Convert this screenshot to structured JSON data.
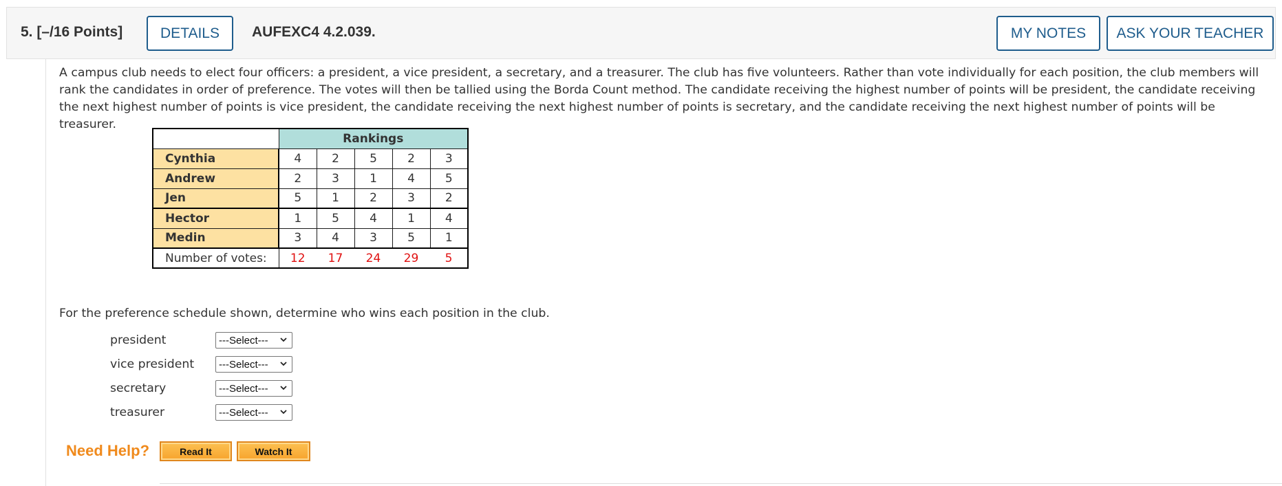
{
  "header": {
    "question_number": "5.  [–/16 Points]",
    "details_label": "DETAILS",
    "question_code": "AUFEXC4 4.2.039.",
    "my_notes_label": "MY NOTES",
    "ask_teacher_label": "ASK YOUR TEACHER"
  },
  "intro_text": "A campus club needs to elect four officers: a president, a vice president, a secretary, and a treasurer. The club has five volunteers. Rather than vote individually for each position, the club members will rank the candidates in order of preference. The votes will then be tallied using the Borda Count method. The candidate receiving the highest number of points will be president, the candidate receiving the next highest number of points is vice president, the candidate receiving the next highest number of points is secretary, and the candidate receiving the next highest number of points will be treasurer.",
  "table": {
    "header": "Rankings",
    "rows": [
      {
        "name": "Cynthia",
        "values": [
          "4",
          "2",
          "5",
          "2",
          "3"
        ]
      },
      {
        "name": "Andrew",
        "values": [
          "2",
          "3",
          "1",
          "4",
          "5"
        ]
      },
      {
        "name": "Jen",
        "values": [
          "5",
          "1",
          "2",
          "3",
          "2"
        ]
      },
      {
        "name": "Hector",
        "values": [
          "1",
          "5",
          "4",
          "1",
          "4"
        ]
      },
      {
        "name": "Medin",
        "values": [
          "3",
          "4",
          "3",
          "5",
          "1"
        ]
      }
    ],
    "votes_label": "Number of votes:",
    "votes": [
      "12",
      "17",
      "24",
      "29",
      "5"
    ]
  },
  "question_text": "For the preference schedule shown, determine who wins each position in the club.",
  "positions": [
    {
      "label": "president",
      "selected": "---Select---"
    },
    {
      "label": "vice president",
      "selected": "---Select---"
    },
    {
      "label": "secretary",
      "selected": "---Select---"
    },
    {
      "label": "treasurer",
      "selected": "---Select---"
    }
  ],
  "help": {
    "label": "Need Help?",
    "read_label": "Read It",
    "watch_label": "Watch It"
  },
  "colors": {
    "accent": "#1e5c8c",
    "rankings_header": "#b1dedb",
    "name_cell": "#fde1a2",
    "votes_text": "#e01010",
    "need_help": "#f08a1c",
    "help_button": "#f7a42d"
  }
}
